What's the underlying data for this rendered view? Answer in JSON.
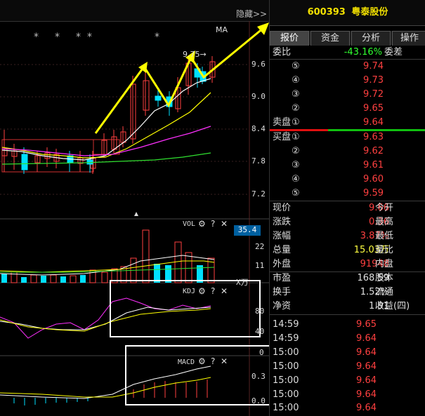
{
  "hide_button": "隐藏>>",
  "ma_label": "MA",
  "price_callout": "9.75→",
  "price_axis": [
    "9.6",
    "9.0",
    "8.4",
    "7.8",
    "7.2"
  ],
  "vol": {
    "label": "VOL",
    "axis": [
      "35.4",
      "22",
      "11"
    ],
    "unit": "X万"
  },
  "kdj": {
    "label": "KDJ",
    "axis": [
      "80",
      "40"
    ]
  },
  "macd": {
    "label": "MACD",
    "axis": [
      "0",
      "0.3",
      "0.0"
    ]
  },
  "indicator_buttons": {
    "settings": "⚙",
    "help": "?",
    "close": "✕"
  },
  "stock": {
    "code": "600393",
    "name": "粤泰股份"
  },
  "tabs": [
    "报价",
    "资金",
    "分析",
    "操作"
  ],
  "weibi": {
    "label": "委比",
    "value": "-43.16%",
    "label2": "委差"
  },
  "sell": [
    {
      "n": "⑤",
      "price": "9.74"
    },
    {
      "n": "④",
      "price": "9.73"
    },
    {
      "n": "③",
      "price": "9.72"
    },
    {
      "n": "②",
      "price": "9.65"
    },
    {
      "n": "①",
      "label": "卖盘",
      "price": "9.64"
    }
  ],
  "buy": [
    {
      "n": "①",
      "label": "买盘",
      "price": "9.63"
    },
    {
      "n": "②",
      "price": "9.62"
    },
    {
      "n": "③",
      "price": "9.61"
    },
    {
      "n": "④",
      "price": "9.60"
    },
    {
      "n": "⑤",
      "price": "9.59"
    }
  ],
  "quote": [
    {
      "label": "现价",
      "value": "9.66",
      "label2": "今开",
      "color": "#ff4040"
    },
    {
      "label": "涨跌",
      "value": "0.36",
      "label2": "最高",
      "color": "#ff4040"
    },
    {
      "label": "涨幅",
      "value": "3.87%",
      "label2": "最低",
      "color": "#ff4040"
    },
    {
      "label": "总量",
      "value": "15.03万",
      "label2": "量比",
      "color": "#ffff40"
    },
    {
      "label": "外盘",
      "value": "91948",
      "label2": "内盘",
      "color": "#ff4040"
    },
    {
      "label": "市盈",
      "value": "168.59",
      "label2": "股本",
      "color": "#e0e0e0"
    },
    {
      "label": "换手",
      "value": "1.52%",
      "label2": "流通",
      "color": "#e0e0e0"
    },
    {
      "label": "净资",
      "value": "1.91",
      "label2": "收益(四)",
      "color": "#e0e0e0"
    }
  ],
  "ticks": [
    {
      "time": "14:59",
      "price": "9.65"
    },
    {
      "time": "14:59",
      "price": "9.64"
    },
    {
      "time": "15:00",
      "price": "9.64"
    },
    {
      "time": "15:00",
      "price": "9.64"
    },
    {
      "time": "15:00",
      "price": "9.64"
    },
    {
      "time": "15:00",
      "price": "9.64"
    },
    {
      "time": "15:00",
      "price": "9.64"
    }
  ],
  "colors": {
    "up": "#ff4040",
    "down": "#00e0ff",
    "annotation": "#ffff00",
    "highlight_box": "#ffffff"
  }
}
